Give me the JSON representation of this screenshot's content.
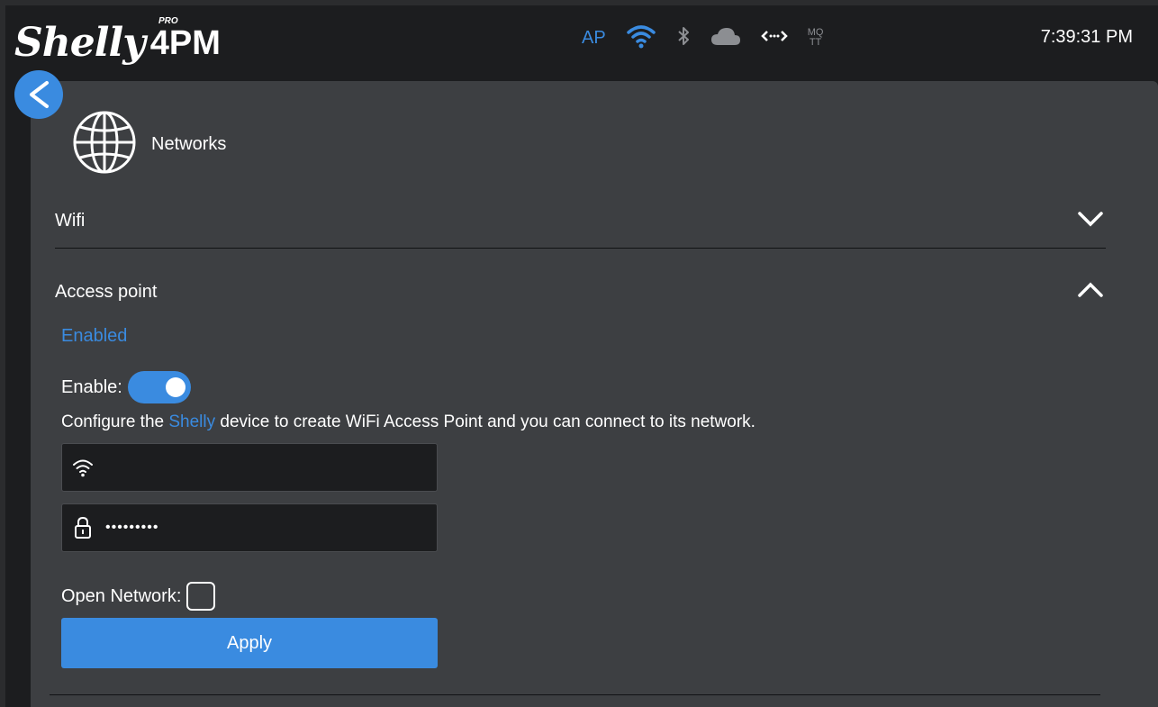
{
  "app": {
    "logo_brand": "Shelly",
    "logo_pro": "PRO",
    "logo_model": "4PM"
  },
  "status_bar": {
    "ap_label": "AP",
    "mqtt_top": "MQ",
    "mqtt_bottom": "TT",
    "time": "7:39:31 PM",
    "icons": [
      "wifi-icon",
      "bluetooth-icon",
      "cloud-icon",
      "websocket-icon"
    ],
    "colors": {
      "active": "#3a8be0",
      "inactive": "#8c8e92"
    }
  },
  "page": {
    "title": "Networks",
    "icon": "globe-icon"
  },
  "sections": {
    "wifi": {
      "label": "Wifi",
      "expanded": false
    },
    "access_point": {
      "label": "Access point",
      "expanded": true,
      "status": "Enabled",
      "enable_label": "Enable:",
      "enabled": true,
      "description_prefix": "Configure the ",
      "description_highlight": "Shelly",
      "description_suffix": " device to create WiFi Access Point and you can connect to its network.",
      "ssid_value": "",
      "password_value": "•••••••••",
      "open_network_label": "Open Network:",
      "open_network": false,
      "apply_label": "Apply"
    }
  },
  "colors": {
    "accent": "#3a8be0",
    "panel": "#3d3f42",
    "header": "#1c1d1f"
  }
}
